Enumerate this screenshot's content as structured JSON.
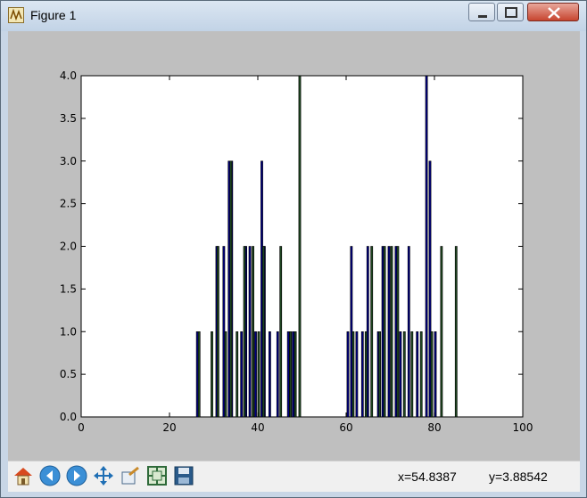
{
  "window": {
    "title": "Figure 1"
  },
  "chart_data": {
    "type": "bar",
    "xlim": [
      0,
      100
    ],
    "ylim": [
      0,
      4
    ],
    "grid": false,
    "x_ticks": [
      "0",
      "20",
      "40",
      "60",
      "80",
      "100"
    ],
    "y_ticks": [
      "0.0",
      "0.5",
      "1.0",
      "1.5",
      "2.0",
      "2.5",
      "3.0",
      "3.5",
      "4.0"
    ],
    "series": [
      {
        "color": "#000080",
        "x": [
          26.3,
          30.7,
          32.3,
          33.5,
          34.1,
          36.3,
          37.3,
          38.2,
          39.5,
          40.9,
          41.5,
          42.7,
          44.5,
          46.9,
          48.0,
          60.4,
          61.2,
          62.4,
          63.7,
          64.9,
          67.3,
          68.3,
          69.7,
          71.3,
          72.3,
          74.2,
          76.1,
          78.2,
          79.0,
          80.2
        ],
        "values": [
          1,
          2,
          2,
          3,
          3,
          1,
          2,
          2,
          1,
          3,
          2,
          1,
          1,
          1,
          1,
          1,
          2,
          1,
          1,
          2,
          1,
          2,
          2,
          2,
          1,
          2,
          1,
          4,
          3,
          1
        ]
      },
      {
        "color": "#1e4620",
        "x": [
          26.7,
          29.6,
          31.0,
          32.7,
          33.9,
          35.3,
          37.0,
          38.9,
          40.2,
          41.3,
          45.2,
          47.4,
          48.5,
          49.5,
          61.6,
          64.5,
          65.8,
          67.6,
          68.7,
          70.3,
          71.7,
          73.2,
          74.9,
          77.0,
          79.4,
          81.6,
          84.9
        ],
        "values": [
          1,
          1,
          2,
          1,
          3,
          1,
          2,
          2,
          1,
          2,
          2,
          1,
          1,
          4,
          1,
          1,
          2,
          1,
          2,
          2,
          2,
          1,
          1,
          1,
          1,
          2,
          2
        ]
      }
    ]
  },
  "toolbar": {
    "tools": [
      "home-icon",
      "back-arrow-icon",
      "forward-arrow-icon",
      "pan-move-icon",
      "zoom-rect-icon",
      "subplot-config-icon",
      "save-floppy-icon"
    ],
    "x_readout": "x=54.8387",
    "y_readout": "y=3.88542"
  }
}
